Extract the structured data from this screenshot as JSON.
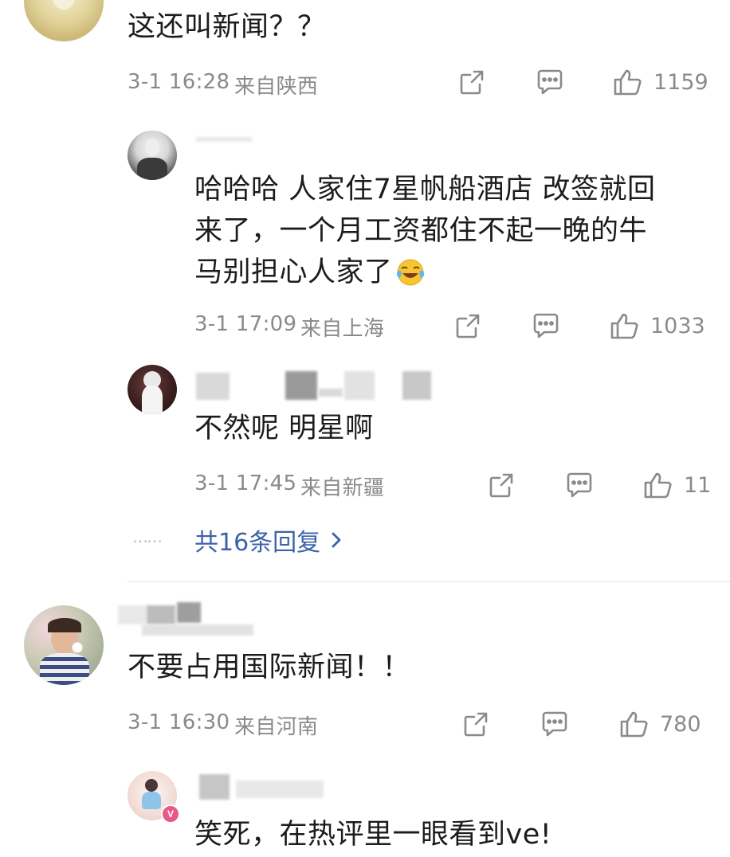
{
  "comments": [
    {
      "text": "这还叫新闻？？",
      "time": "3-1 16:28",
      "location": "来自陕西",
      "likes": "1159",
      "replies": [
        {
          "text_lines": [
            "哈哈哈 人家住7星帆船酒店 改签就回",
            "来了，一个月工资都住不起一晚的牛",
            "马别担心人家了"
          ],
          "emoji": "laugh-cry-emoji",
          "time": "3-1 17:09",
          "location": "来自上海",
          "likes": "1033"
        },
        {
          "text": "不然呢 明星啊",
          "time": "3-1 17:45",
          "location": "来自新疆",
          "likes": "11"
        }
      ],
      "more_replies": "共16条回复",
      "more_dots": "……"
    },
    {
      "text": "不要占用国际新闻！！",
      "time": "3-1 16:30",
      "location": "来自河南",
      "likes": "780",
      "replies": [
        {
          "text": "笑死，在热评里一眼看到ve!",
          "badge": "V"
        }
      ]
    }
  ],
  "colors": {
    "meta": "#8a8a8a",
    "link": "#3b62a9",
    "badge": "#e75a86"
  }
}
